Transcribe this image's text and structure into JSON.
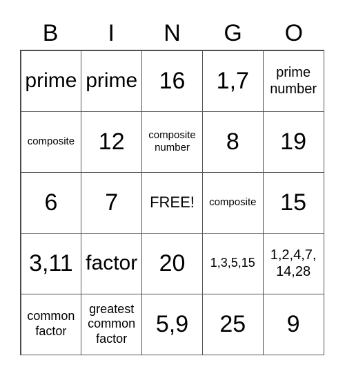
{
  "header": [
    "B",
    "I",
    "N",
    "G",
    "O"
  ],
  "cells": [
    [
      "prime",
      "prime",
      "16",
      "1,7",
      "prime number"
    ],
    [
      "composite",
      "12",
      "composite number",
      "8",
      "19"
    ],
    [
      "6",
      "7",
      "FREE!",
      "composite",
      "15"
    ],
    [
      "3,11",
      "factor",
      "20",
      "1,3,5,15",
      "1,2,4,7, 14,28"
    ],
    [
      "common factor",
      "greatest common factor",
      "5,9",
      "25",
      "9"
    ]
  ]
}
